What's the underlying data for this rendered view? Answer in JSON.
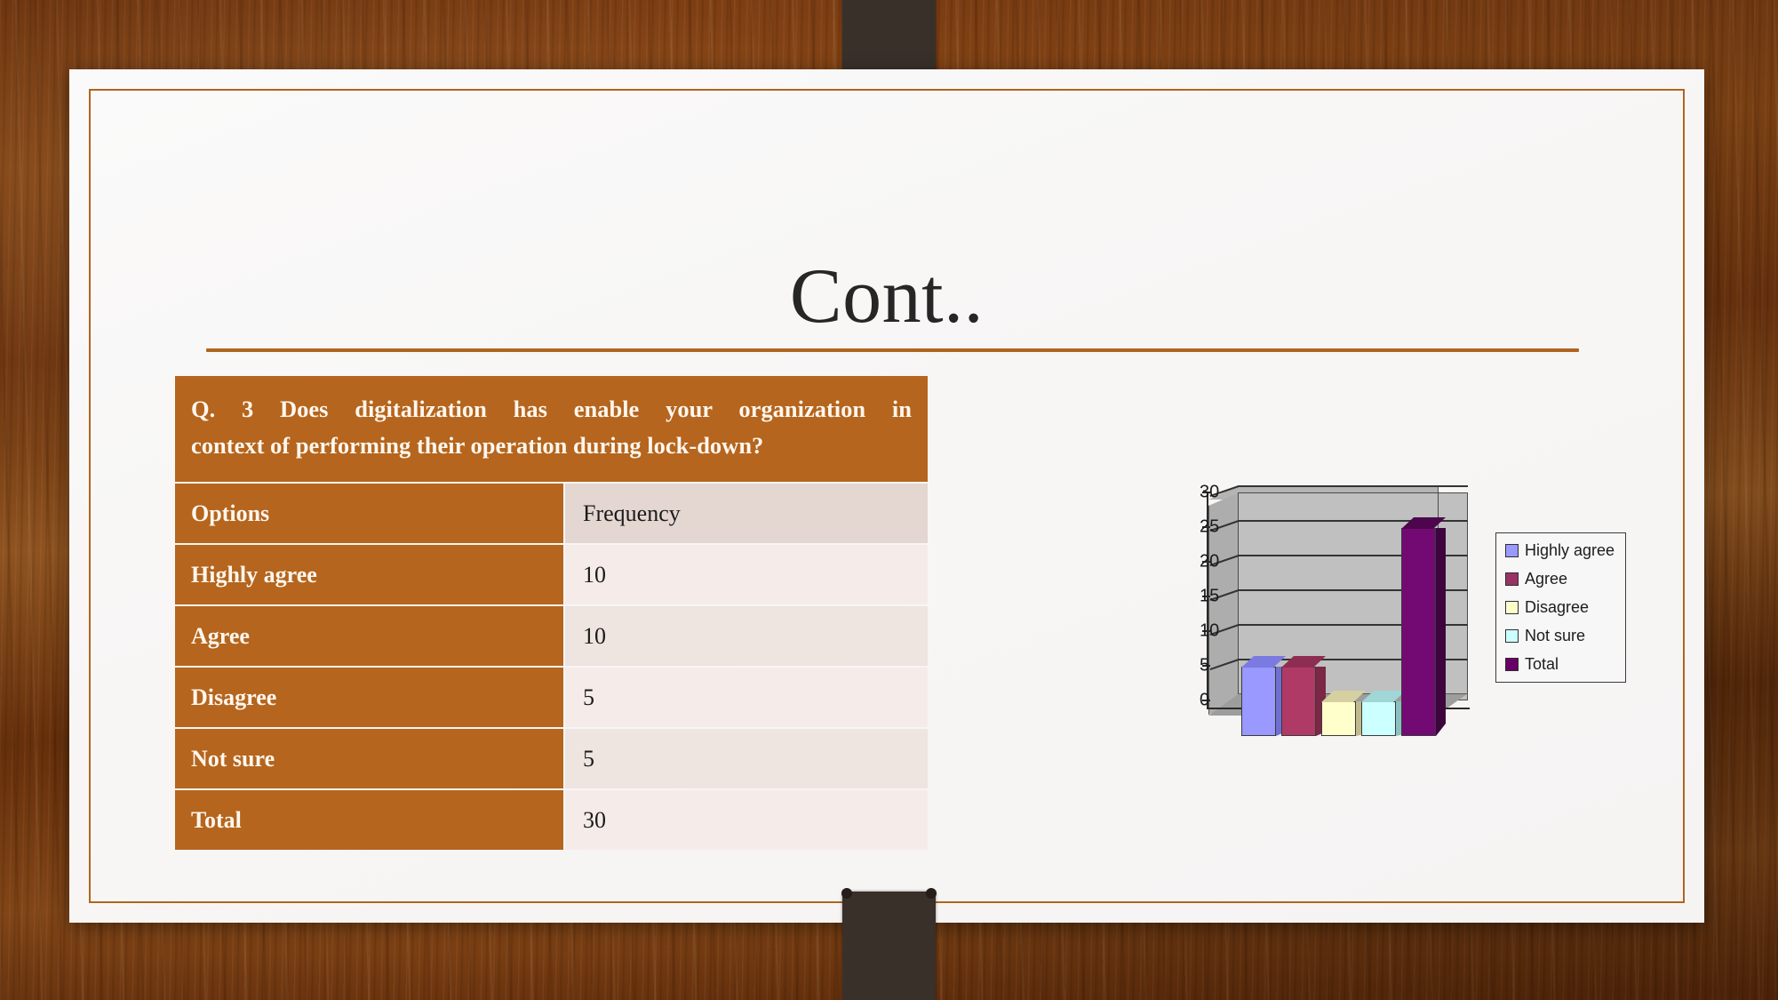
{
  "slide": {
    "title": "Cont..",
    "table": {
      "question": "Q. 3 Does digitalization has enable your organization in context of performing their operation during lock-down?",
      "question_line1": "Q. 3 Does digitalization has enable your organization in",
      "question_line2": "context of performing their operation during lock-down?",
      "columns": [
        "Options",
        "Frequency"
      ],
      "rows": [
        {
          "option": "Highly agree",
          "frequency": "10"
        },
        {
          "option": "Agree",
          "frequency": "10"
        },
        {
          "option": "Disagree",
          "frequency": "5"
        },
        {
          "option": "Not sure",
          "frequency": "5"
        },
        {
          "option": " Total",
          "frequency": "30"
        }
      ]
    },
    "colors": {
      "table_header_orange": "#b5651d",
      "accent_rule": "#b0651f",
      "slide_bg": "#f8f7f6",
      "tape": "#39302a",
      "desk_wood": "#7b3c12"
    }
  },
  "chart_data": {
    "type": "bar",
    "title": "",
    "xlabel": "",
    "ylabel": "",
    "categories": [
      "Highly agree",
      "Agree",
      "Disagree",
      "Not sure",
      "Total"
    ],
    "values": [
      10,
      10,
      5,
      5,
      30
    ],
    "ylim": [
      0,
      30
    ],
    "yticks": [
      "0",
      "5",
      "10",
      "15",
      "20",
      "25",
      "30"
    ],
    "gridlines": [
      5,
      10,
      15,
      20,
      25,
      30
    ],
    "grid": true,
    "legend_position": "right",
    "style": "3d-column",
    "legend": [
      {
        "label": "Highly agree",
        "color": "#9999ff"
      },
      {
        "label": "Agree",
        "color": "#993366"
      },
      {
        "label": "Disagree",
        "color": "#ffffcc"
      },
      {
        "label": "Not sure",
        "color": "#ccffff"
      },
      {
        "label": "Total",
        "color": "#660066"
      }
    ],
    "series": [
      {
        "name": "Highly agree",
        "value": 10,
        "color": "#9999ff",
        "top_color": "#7a7ae0",
        "side_color": "#6f6fd0"
      },
      {
        "name": "Agree",
        "value": 10,
        "color": "#b03a66",
        "top_color": "#8d2d52",
        "side_color": "#7b2746"
      },
      {
        "name": "Disagree",
        "value": 5,
        "color": "#ffffcc",
        "top_color": "#d6d0a0",
        "side_color": "#bfb98c"
      },
      {
        "name": "Not sure",
        "value": 5,
        "color": "#ccffff",
        "top_color": "#a0d6d6",
        "side_color": "#8cbfbf"
      },
      {
        "name": "Total",
        "value": 30,
        "color": "#730a73",
        "top_color": "#4d064d",
        "side_color": "#3d053d"
      }
    ]
  }
}
